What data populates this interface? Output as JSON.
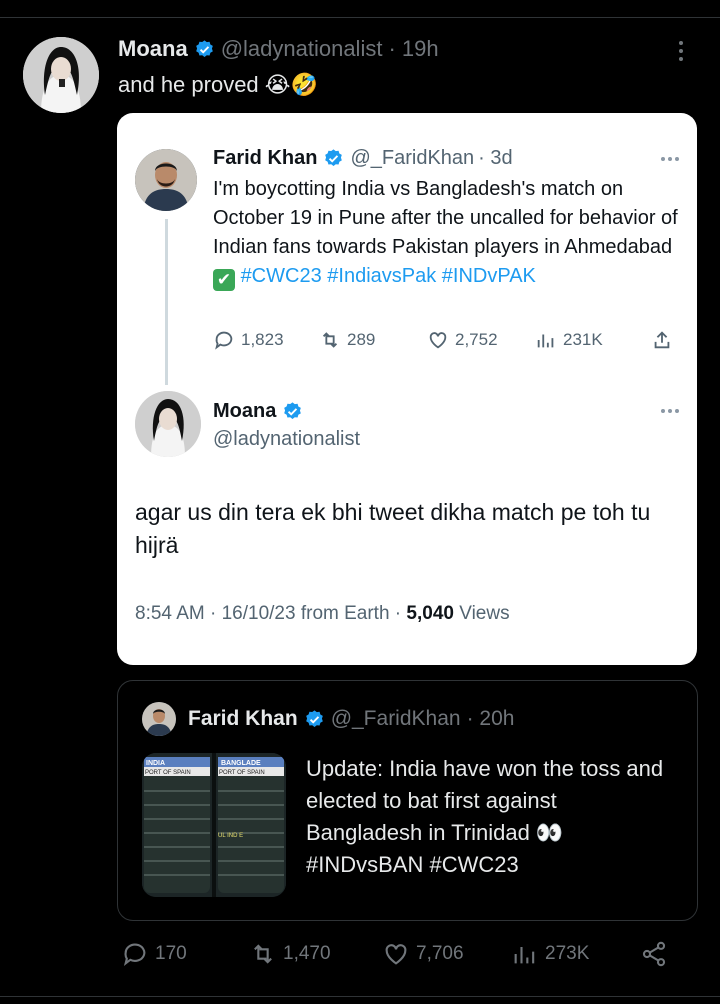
{
  "tweet": {
    "author_name": "Moana",
    "author_handle": "@ladynationalist",
    "time": "· 19h",
    "text": "and he proved 😭🤣",
    "stats": {
      "replies": "170",
      "retweets": "1,470",
      "likes": "7,706",
      "views": "273K"
    }
  },
  "screenshot_card": {
    "original": {
      "name": "Farid Khan",
      "handle": "@_FaridKhan",
      "time": "· 3d",
      "text_before": "I'm boycotting India vs Bangladesh's match on October 19 in Pune after the uncalled for behavior of Indian fans towards Pakistan players in Ahmedabad",
      "emoji": "✔",
      "hashtag1": "#CWC23",
      "hashtag2": "#IndiavsPak",
      "hashtag3": "#INDvPAK",
      "stats": {
        "replies": "1,823",
        "retweets": "289",
        "likes": "2,752",
        "views": "231K"
      }
    },
    "reply": {
      "name": "Moana",
      "handle": "@ladynationalist",
      "text": "agar us din tera ek bhi tweet dikha match pe toh tu hijrä",
      "meta_time": "8:54 AM · 16/10/23 from Earth ·",
      "views_count": "5,040",
      "views_label": "Views"
    }
  },
  "quote_card": {
    "name": "Farid Khan",
    "handle": "@_FaridKhan",
    "time": "· 20h",
    "text": "Update: India have won the toss and elected to bat first against Bangladesh in Trinidad 👀 #INDvsBAN #CWC23",
    "media_labels": {
      "left_team": "INDIA",
      "left_place": "PORT OF SPAIN",
      "right_team": "BANGLADE",
      "right_place": "PORT OF SPAIN",
      "scrap": "UL IND E"
    }
  },
  "colors": {
    "accent": "#1d9bf0",
    "bg": "#000000",
    "text": "#e7e9ea",
    "muted": "#71767b"
  },
  "icons": [
    "verified-badge-icon",
    "more-icon",
    "reply-icon",
    "retweet-icon",
    "like-icon",
    "views-icon",
    "share-icon"
  ]
}
